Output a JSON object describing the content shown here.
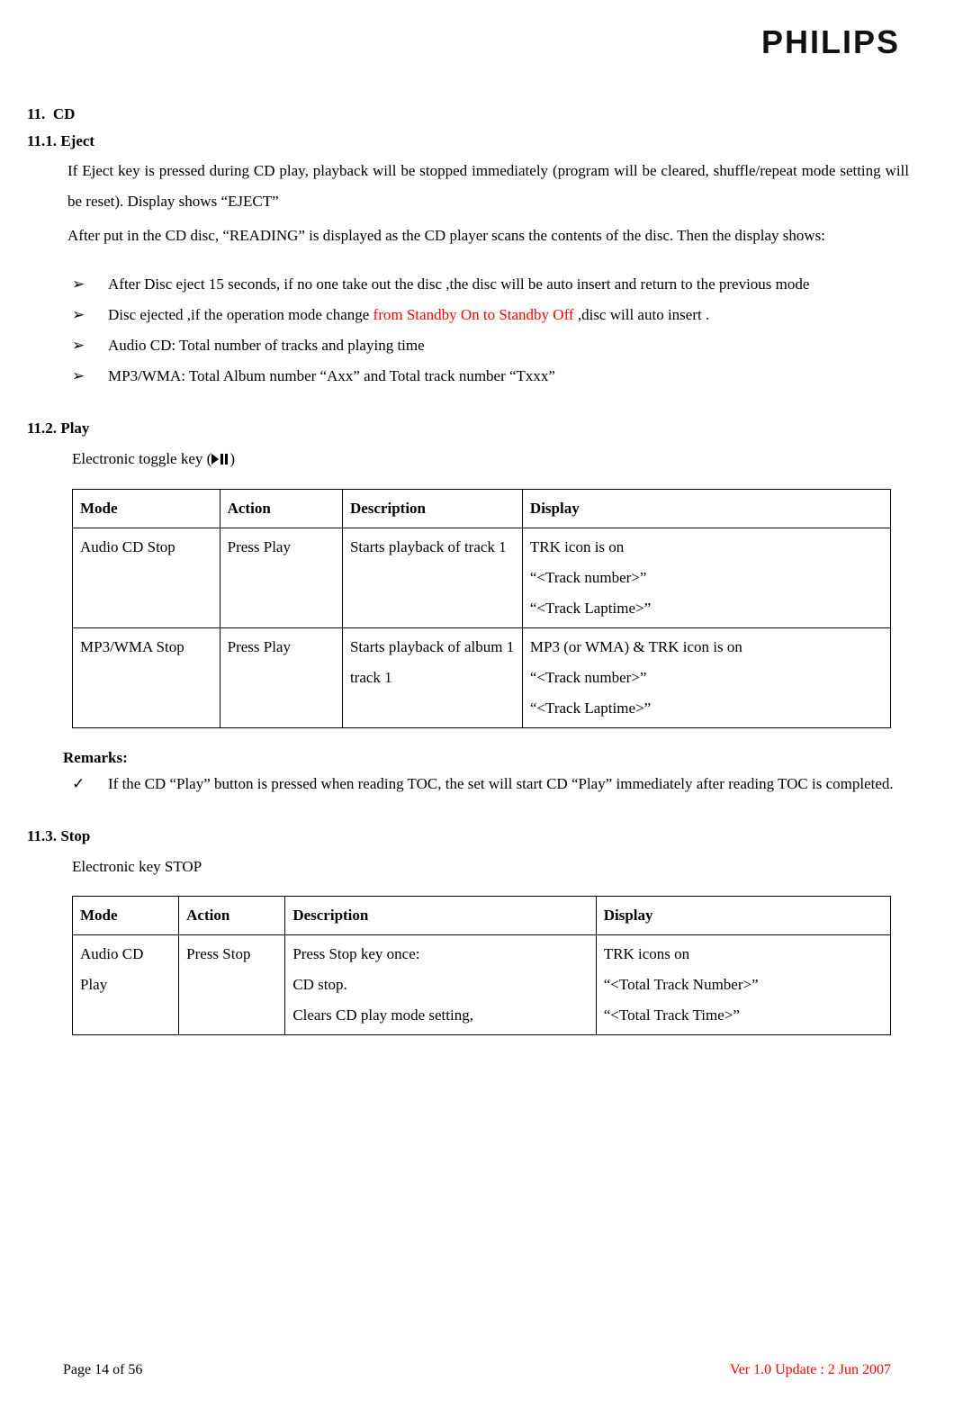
{
  "logo": "PHILIPS",
  "section11": {
    "number": "11.",
    "title": "CD"
  },
  "section11_1": {
    "number": "11.1.",
    "title": "Eject",
    "para1": "If Eject key is pressed during CD play, playback will be stopped immediately (program will be cleared, shuffle/repeat mode setting will be reset). Display shows “EJECT”",
    "para2": "After put in the CD disc, “READING” is displayed as the CD player scans the contents of the disc. Then the display shows:",
    "bullets": [
      {
        "text": "After Disc eject 15 seconds, if no one take out the disc ,the disc will be auto insert and return to the previous mode"
      },
      {
        "text_pre": "Disc ejected ,if the operation mode change ",
        "text_red": "from Standby On to Standby Off",
        "text_post": " ,disc will auto insert ."
      },
      {
        "text": "Audio CD: Total number of tracks and playing time"
      },
      {
        "text": "MP3/WMA: Total Album number “Axx” and Total track number “Txxx”"
      }
    ]
  },
  "section11_2": {
    "number": "11.2.",
    "title": "Play",
    "desc": "Electronic toggle key (",
    "desc_end": ")",
    "table": {
      "headers": [
        "Mode",
        "Action",
        "Description",
        "Display"
      ],
      "rows": [
        {
          "mode": "Audio CD Stop",
          "action": "Press Play",
          "desc": "Starts playback of track 1",
          "display": "TRK icon is on\n“<Track number>”\n“<Track Laptime>”"
        },
        {
          "mode": "MP3/WMA Stop",
          "action": "Press Play",
          "desc": "Starts playback of album 1 track 1",
          "display": "MP3 (or WMA) & TRK icon is on\n“<Track number>”\n“<Track Laptime>”"
        }
      ]
    },
    "remarks_title": "Remarks:",
    "remarks": [
      "If the CD “Play” button is pressed when reading TOC, the set will start CD “Play” immediately after reading TOC is completed."
    ]
  },
  "section11_3": {
    "number": "11.3.",
    "title": "Stop",
    "desc": "Electronic key STOP",
    "table": {
      "headers": [
        "Mode",
        "Action",
        "Description",
        "Display"
      ],
      "rows": [
        {
          "mode": "Audio CD Play",
          "action": "Press Stop",
          "desc": "Press Stop key once:\nCD stop.\nClears CD play mode setting,",
          "display": "TRK icons on\n“<Total Track Number>”\n“<Total Track Time>”"
        }
      ]
    }
  },
  "footer": {
    "page": "Page 14 of 56",
    "version": "Ver 1.0    Update : 2 Jun 2007"
  }
}
